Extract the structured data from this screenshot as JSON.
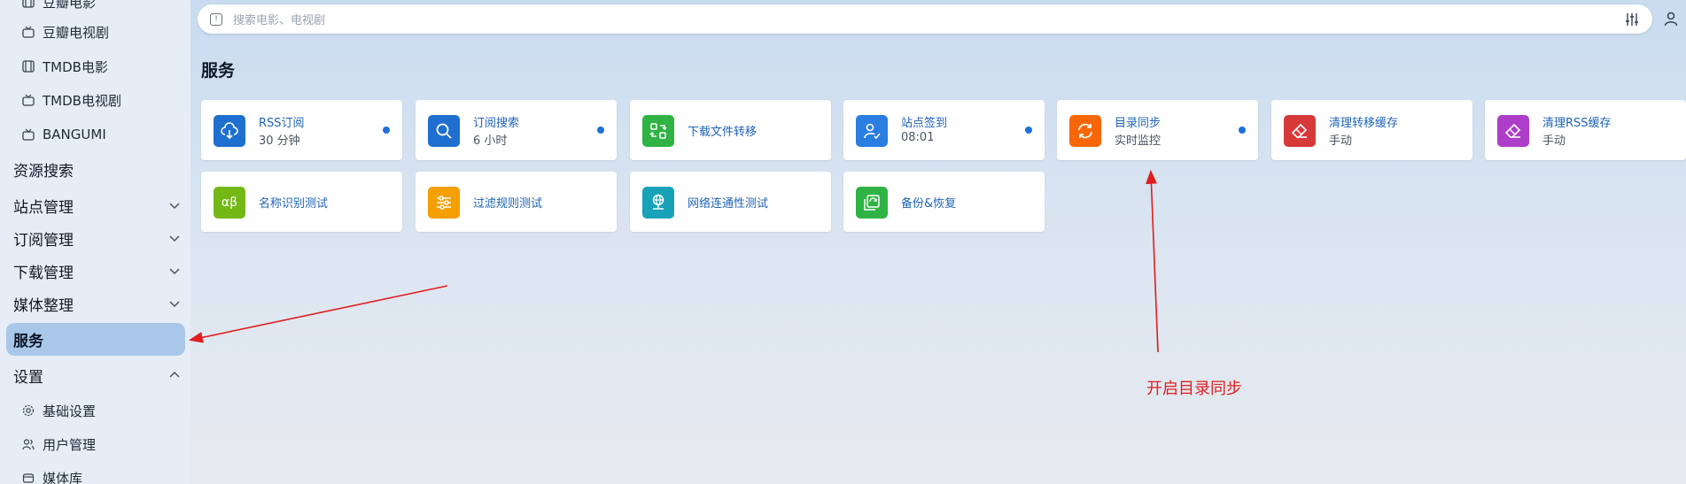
{
  "sidebar": {
    "sub_top": [
      {
        "label": "豆瓣电影",
        "icon": "film-icon"
      },
      {
        "label": "豆瓣电视剧",
        "icon": "tv-icon"
      },
      {
        "label": "TMDB电影",
        "icon": "film-icon"
      },
      {
        "label": "TMDB电视剧",
        "icon": "tv-icon"
      },
      {
        "label": "BANGUMI",
        "icon": "tv-icon"
      }
    ],
    "resource_search": "资源搜索",
    "groups": [
      {
        "label": "站点管理"
      },
      {
        "label": "订阅管理"
      },
      {
        "label": "下载管理"
      },
      {
        "label": "媒体整理"
      }
    ],
    "active": "服务",
    "settings": "设置",
    "sub_bottom": [
      {
        "label": "基础设置",
        "icon": "gear-icon"
      },
      {
        "label": "用户管理",
        "icon": "users-icon"
      },
      {
        "label": "媒体库",
        "icon": "library-icon"
      }
    ]
  },
  "search": {
    "placeholder": "搜索电影、电视剧",
    "kbd": "!"
  },
  "page": {
    "title": "服务"
  },
  "cards": [
    {
      "title": "RSS订阅",
      "sub": "30 分钟",
      "color": "#1e6fcf",
      "icon": "cloud-download-icon",
      "dot": true
    },
    {
      "title": "订阅搜索",
      "sub": "6 小时",
      "color": "#1e6fcf",
      "icon": "search-icon",
      "dot": true
    },
    {
      "title": "下载文件转移",
      "sub": "",
      "color": "#2fb344",
      "icon": "transfer-icon",
      "dot": false
    },
    {
      "title": "站点签到",
      "sub": "08:01",
      "color": "#2a7de1",
      "icon": "user-check-icon",
      "dot": true
    },
    {
      "title": "目录同步",
      "sub": "实时监控",
      "color": "#f76707",
      "icon": "refresh-icon",
      "dot": true
    },
    {
      "title": "清理转移缓存",
      "sub": "手动",
      "color": "#d63939",
      "icon": "eraser-icon",
      "dot": false
    },
    {
      "title": "清理RSS缓存",
      "sub": "手动",
      "color": "#ae3ec9",
      "icon": "eraser-icon",
      "dot": false
    },
    {
      "title": "名称识别测试",
      "sub": "",
      "color": "#74b816",
      "icon": "alpha-beta-icon",
      "dot": false
    },
    {
      "title": "过滤规则测试",
      "sub": "",
      "color": "#f59f00",
      "icon": "filter-sliders-icon",
      "dot": false
    },
    {
      "title": "网络连通性测试",
      "sub": "",
      "color": "#17a2b8",
      "icon": "network-icon",
      "dot": false
    },
    {
      "title": "备份&恢复",
      "sub": "",
      "color": "#2fb344",
      "icon": "backup-icon",
      "dot": false
    }
  ],
  "annotation": {
    "text": "开启目录同步",
    "color": "#e11d1d"
  }
}
